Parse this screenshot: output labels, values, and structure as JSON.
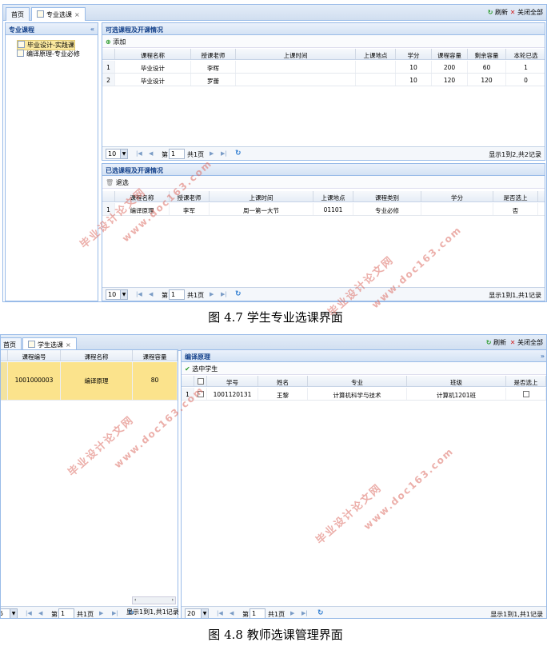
{
  "fig1": {
    "tabs": [
      {
        "label": "首页"
      },
      {
        "label": "专业选课",
        "close": "×"
      }
    ],
    "toolbar": {
      "refresh": "刷新",
      "close_all": "关闭全部"
    },
    "left_panel": {
      "title": "专业课程",
      "collapse": "«",
      "items": [
        "毕业设计-实践课",
        "编译原理-专业必修"
      ]
    },
    "top": {
      "title": "可选课程及开课情况",
      "add": "添加",
      "columns": [
        "",
        "课程名称",
        "授课老师",
        "上课时间",
        "上课地点",
        "学分",
        "课程容量",
        "剩余容量",
        "本轮已选"
      ],
      "rows": [
        [
          "1",
          "毕业设计",
          "李晖",
          "",
          "",
          "10",
          "200",
          "60",
          "1"
        ],
        [
          "2",
          "毕业设计",
          "罗蕾",
          "",
          "",
          "10",
          "120",
          "120",
          "0"
        ]
      ],
      "pager": {
        "size": "10",
        "page_prefix": "第",
        "page": "1",
        "page_suffix": "共1页",
        "info": "显示1到2,共2记录"
      }
    },
    "bottom": {
      "title": "已选课程及开课情况",
      "withdraw": "退选",
      "columns": [
        "",
        "课程名称",
        "授课老师",
        "上课时间",
        "上课地点",
        "课程类别",
        "学分",
        "是否选上"
      ],
      "rows": [
        [
          "1",
          "编译原理",
          "李军",
          "周一第一大节",
          "01101",
          "专业必修",
          "",
          "否"
        ]
      ],
      "pager": {
        "size": "10",
        "page_prefix": "第",
        "page": "1",
        "page_suffix": "共1页",
        "info": "显示1到1,共1记录"
      }
    },
    "caption": "图 4.7 学生专业选课界面"
  },
  "fig2": {
    "tabs": [
      {
        "label": "首页"
      },
      {
        "label": "学生选课",
        "close": "×"
      }
    ],
    "toolbar": {
      "refresh": "刷新",
      "close_all": "关闭全部"
    },
    "left": {
      "columns": [
        "课程编号",
        "课程名称",
        "课程容量"
      ],
      "rows": [
        [
          "1001000003",
          "编译原理",
          "80"
        ]
      ],
      "pager": {
        "size": "5",
        "page_prefix": "第",
        "page": "1",
        "page_suffix": "共1页",
        "info": "显示1到1,共1记录"
      }
    },
    "right": {
      "title": "编译原理",
      "expand": "»",
      "confirm": "选中学生",
      "columns": [
        "",
        "",
        "学号",
        "姓名",
        "专业",
        "班级",
        "是否选上"
      ],
      "rows": [
        [
          "1",
          "",
          "1001120131",
          "王黎",
          "计算机科学与技术",
          "计算机1201班",
          ""
        ]
      ],
      "pager": {
        "size": "20",
        "page_prefix": "第",
        "page": "1",
        "page_suffix": "共1页",
        "info": "显示1到1,共1记录"
      }
    },
    "caption": "图 4.8 教师选课管理界面"
  },
  "watermarks": {
    "cn": "毕业设计论文网",
    "en": "www.doc163.com"
  },
  "colors": {
    "panel_border": "#99bbe8",
    "header_text": "#15428b",
    "selected_row": "#fbe38c",
    "watermark": "#dc6e64"
  }
}
